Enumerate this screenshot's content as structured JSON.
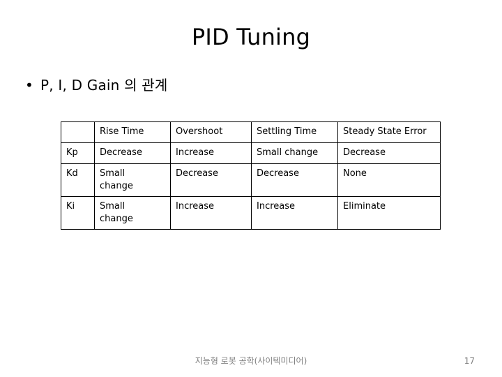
{
  "slide": {
    "title": "PID Tuning",
    "bullet": {
      "marker": "•",
      "text": "P, I, D Gain 의 관계"
    }
  },
  "table": {
    "columns": [
      "",
      "Rise Time",
      "Overshoot",
      "Settling Time",
      "Steady State Error"
    ],
    "rows": [
      {
        "gain": "Kp",
        "rise_time": "Decrease",
        "overshoot": "Increase",
        "settling_time": "Small change",
        "steady_state_error": "Decrease"
      },
      {
        "gain": "Kd",
        "rise_time": "Small change",
        "overshoot": "Decrease",
        "settling_time": "Decrease",
        "steady_state_error": "None"
      },
      {
        "gain": "Ki",
        "rise_time": "Small change",
        "overshoot": "Increase",
        "settling_time": "Increase",
        "steady_state_error": "Eliminate"
      }
    ]
  },
  "footer": {
    "source": "지능형 로봇 공학(사이텍미디어)",
    "page_number": "17"
  },
  "colors": {
    "text": "#000000",
    "footer_text": "#808080",
    "table_border": "#000000",
    "background": "#ffffff"
  }
}
